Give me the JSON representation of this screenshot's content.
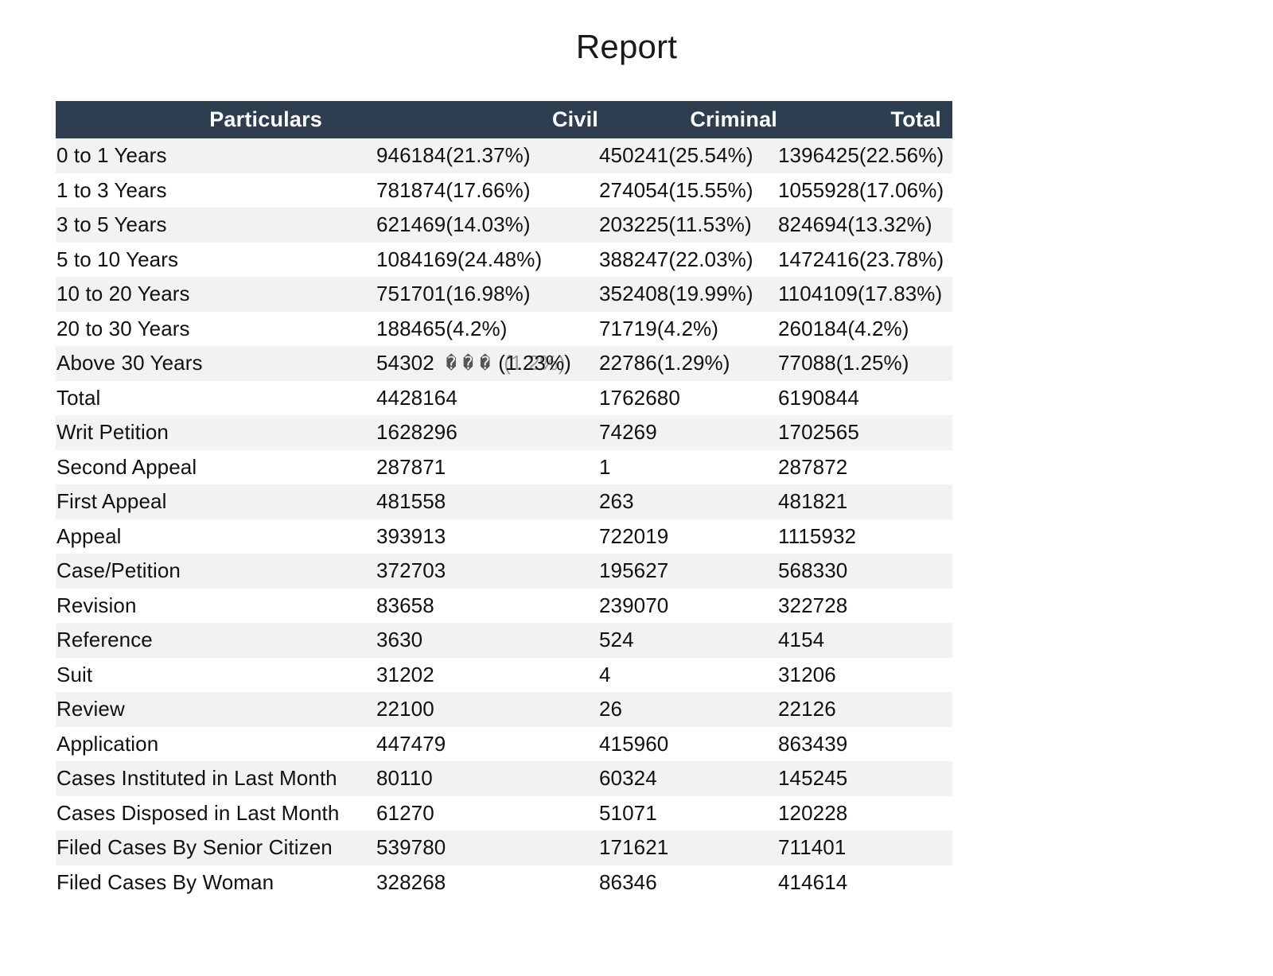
{
  "page": {
    "title": "Report",
    "header_bg": "#2d3e50",
    "header_text_color": "#ffffff",
    "stripe_color": "#f2f2f2",
    "row_color": "#ffffff",
    "text_color": "#111111"
  },
  "table": {
    "columns": [
      "Particulars",
      "Civil",
      "Criminal",
      "Total"
    ],
    "rows": [
      {
        "particulars": "0 to 1 Years",
        "civil": "946184(21.37%)",
        "criminal": "450241(25.54%)",
        "total": "1396425(22.56%)"
      },
      {
        "particulars": "1 to 3 Years",
        "civil": "781874(17.66%)",
        "criminal": "274054(15.55%)",
        "total": "1055928(17.06%)"
      },
      {
        "particulars": "3 to 5 Years",
        "civil": "621469(14.03%)",
        "criminal": "203225(11.53%)",
        "total": "824694(13.32%)"
      },
      {
        "particulars": "5 to 10 Years",
        "civil": "1084169(24.48%)",
        "criminal": "388247(22.03%)",
        "total": "1472416(23.78%)"
      },
      {
        "particulars": "10 to 20 Years",
        "civil": "751701(16.98%)",
        "criminal": "352408(19.99%)",
        "total": "1104109(17.83%)"
      },
      {
        "particulars": "20 to 30 Years",
        "civil": "188465(4.2%)",
        "criminal": "71719(4.2%)",
        "total": "260184(4.2%)"
      },
      {
        "particulars": "Above 30 Years",
        "civil": "54302(1.23%)",
        "criminal": "22786(1.29%)",
        "total": "77088(1.25%)",
        "civil_glitch": {
          "prefix": "54302",
          "tofu": "���",
          "under": "(1.2%)",
          "over": "(1.23%)"
        }
      },
      {
        "particulars": "Total",
        "civil": "4428164",
        "criminal": "1762680",
        "total": "6190844"
      },
      {
        "particulars": "Writ Petition",
        "civil": "1628296",
        "criminal": "74269",
        "total": "1702565"
      },
      {
        "particulars": "Second Appeal",
        "civil": "287871",
        "criminal": "1",
        "total": "287872"
      },
      {
        "particulars": "First Appeal",
        "civil": "481558",
        "criminal": "263",
        "total": "481821"
      },
      {
        "particulars": "Appeal",
        "civil": "393913",
        "criminal": "722019",
        "total": "1115932"
      },
      {
        "particulars": "Case/Petition",
        "civil": "372703",
        "criminal": "195627",
        "total": "568330"
      },
      {
        "particulars": "Revision",
        "civil": "83658",
        "criminal": "239070",
        "total": "322728"
      },
      {
        "particulars": "Reference",
        "civil": "3630",
        "criminal": "524",
        "total": "4154"
      },
      {
        "particulars": "Suit",
        "civil": "31202",
        "criminal": "4",
        "total": "31206"
      },
      {
        "particulars": "Review",
        "civil": "22100",
        "criminal": "26",
        "total": "22126"
      },
      {
        "particulars": "Application",
        "civil": "447479",
        "criminal": "415960",
        "total": "863439"
      },
      {
        "particulars": "Cases Instituted in Last Month",
        "civil": "80110",
        "criminal": "60324",
        "total": "145245"
      },
      {
        "particulars": "Cases Disposed in Last Month",
        "civil": "61270",
        "criminal": "51071",
        "total": "120228"
      },
      {
        "particulars": "Filed Cases By Senior Citizen",
        "civil": "539780",
        "criminal": "171621",
        "total": "711401"
      },
      {
        "particulars": "Filed Cases By Woman",
        "civil": "328268",
        "criminal": "86346",
        "total": "414614"
      }
    ]
  }
}
